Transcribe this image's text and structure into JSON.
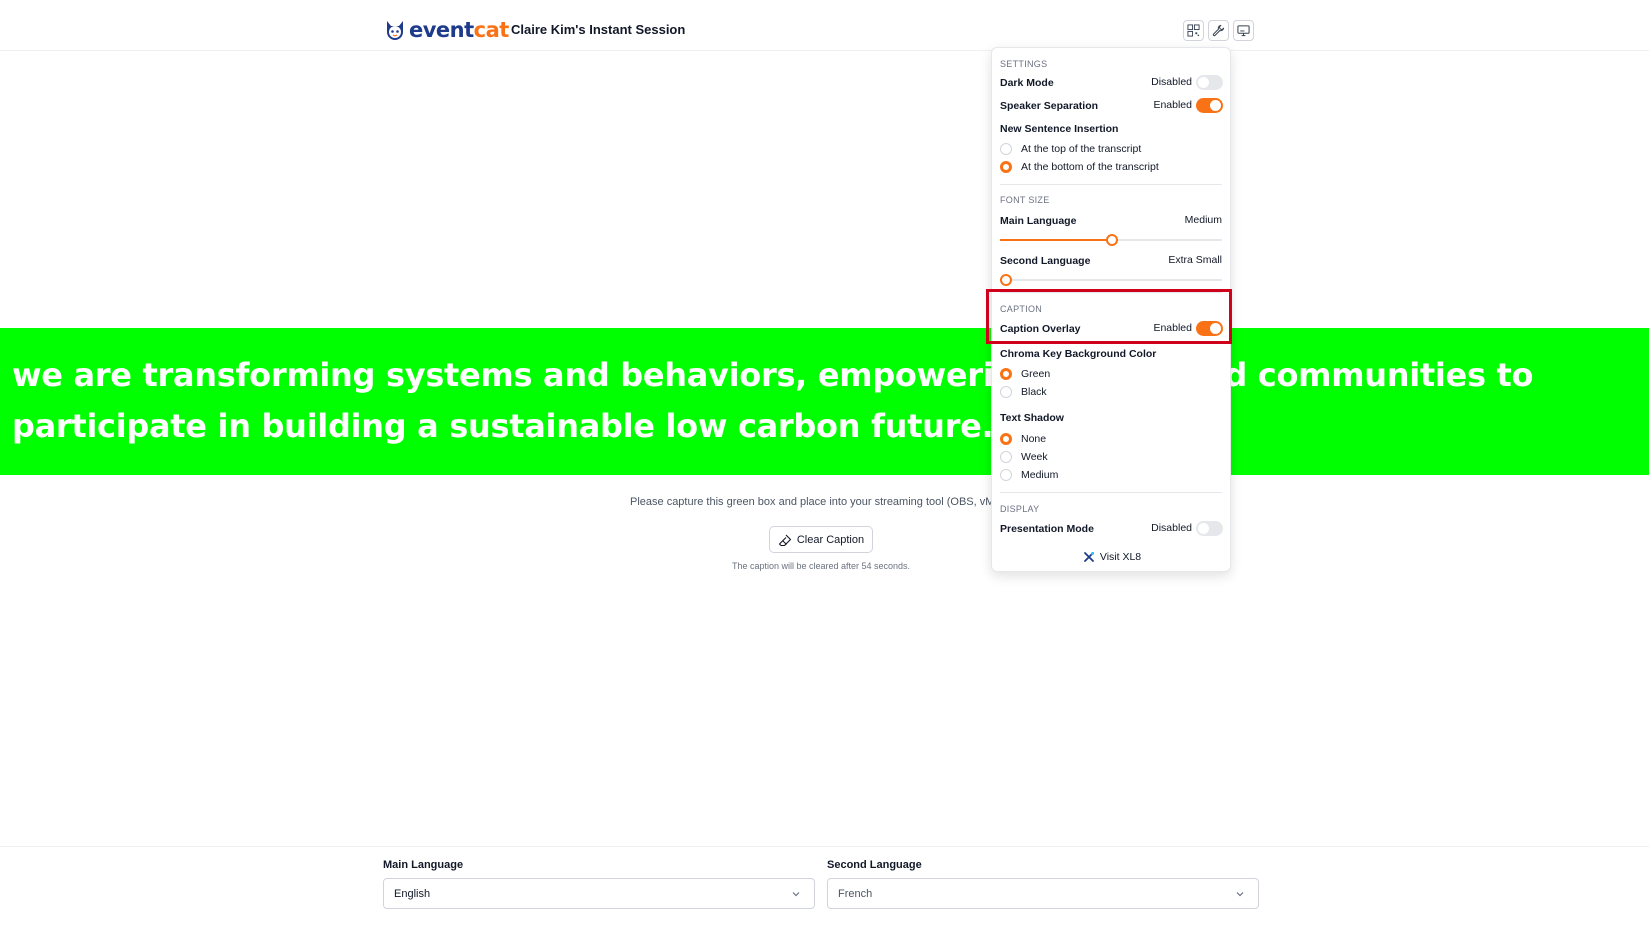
{
  "header": {
    "logo_part1": "event",
    "logo_part2": "cat",
    "session_title": "Claire Kim's Instant Session",
    "tools": [
      {
        "icon": "qr-code-icon"
      },
      {
        "icon": "wrench-icon"
      },
      {
        "icon": "monitor-caption-icon"
      }
    ]
  },
  "caption": {
    "text": "we are transforming systems and behaviors, empowering people and communities to participate in building a sustainable low carbon future. Low car."
  },
  "main": {
    "instruction": "Please capture this green box and place into your streaming tool (OBS, vMix, etc.)",
    "clear_button": "Clear Caption",
    "clear_note": "The caption will be cleared after 54 seconds."
  },
  "settings_panel": {
    "settings_title": "SETTINGS",
    "dark_mode": {
      "label": "Dark Mode",
      "state": "Disabled",
      "on": false
    },
    "speaker_separation": {
      "label": "Speaker Separation",
      "state": "Enabled",
      "on": true
    },
    "new_sentence": {
      "label": "New Sentence Insertion",
      "options": [
        "At the top of the transcript",
        "At the bottom of the transcript"
      ],
      "selected": 1
    },
    "font_size_title": "FONT SIZE",
    "main_language_size": {
      "label": "Main Language",
      "value": "Medium",
      "level": 0.5
    },
    "second_language_size": {
      "label": "Second Language",
      "value": "Extra Small",
      "level": 0.0
    },
    "caption_title": "CAPTION",
    "caption_overlay": {
      "label": "Caption Overlay",
      "state": "Enabled",
      "on": true
    },
    "chroma_key": {
      "label": "Chroma Key Background Color",
      "options": [
        "Green",
        "Black"
      ],
      "selected": 0
    },
    "text_shadow": {
      "label": "Text Shadow",
      "options": [
        "None",
        "Week",
        "Medium"
      ],
      "selected": 0
    },
    "display_title": "DISPLAY",
    "presentation_mode": {
      "label": "Presentation Mode",
      "state": "Disabled",
      "on": false
    },
    "visit_link": "Visit XL8"
  },
  "footer": {
    "main_language_label": "Main Language",
    "main_language_value": "English",
    "second_language_label": "Second Language",
    "second_language_value": "French"
  },
  "colors": {
    "accent": "#f97316",
    "chroma_green": "#00ff00",
    "highlight": "#d0021b",
    "brand_blue": "#1e3a8a"
  }
}
